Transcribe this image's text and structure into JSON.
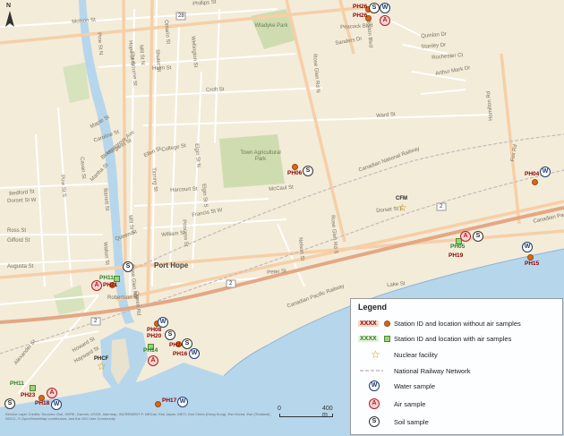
{
  "map": {
    "place_label": "Port Hope",
    "parks": [
      {
        "name": "Wladyke Park"
      },
      {
        "name": "Town Agricultural Park"
      }
    ],
    "streets": [
      "Molson St",
      "Phillips St",
      "Pine St N",
      "Ontario St",
      "Wellington St",
      "Mill St N",
      "Hope St N",
      "Sherbourne St",
      "Shuter St",
      "Helm St",
      "Croft St",
      "Ward St",
      "Peacock Blvd",
      "Sanders Dr",
      "Quinlan Dr",
      "Stanley Dr",
      "Rochester Ct",
      "Arthur Mark Dr",
      "Caroline St",
      "Margaret St",
      "Martha St",
      "Bloomsgrove Ave",
      "College St",
      "Ellen St",
      "Elgin St N",
      "Dorset St W",
      "Bedford St",
      "Pine St S",
      "Harcourt St",
      "Tinning St",
      "Barrett St",
      "McCaul St",
      "Elgin St S",
      "Francis St W",
      "William St",
      "Princess St",
      "Mill St S",
      "Ross St",
      "Gifford St",
      "Augusta St",
      "Robertson St",
      "Peter St",
      "Lake St",
      "Dorset St E",
      "Nelson St",
      "Rose Glen Rd N",
      "Rose Glen Rd S",
      "Hamilton Rd",
      "Bruton Blvd",
      "Alexander St",
      "Howard St",
      "Cavan St",
      "Maple St",
      "Walton St",
      "Hayward St",
      "Queen St",
      "Queen Rd",
      "Rose Glen Rd",
      "Fox Rd",
      "Canadian Pacific Railway",
      "Canadian National Railway",
      "Canadian Pacific"
    ],
    "road_shields": [
      "28",
      "2",
      "2",
      "2"
    ]
  },
  "stations": [
    {
      "id": "PH26",
      "air": false,
      "samples": [
        "S",
        "W"
      ]
    },
    {
      "id": "PH26",
      "air": false,
      "samples": [
        "A"
      ]
    },
    {
      "id": "PH06",
      "air": false,
      "samples": [
        "S"
      ]
    },
    {
      "id": "PH04",
      "air": false,
      "samples": [
        "W"
      ]
    },
    {
      "id": "PH05",
      "air": true,
      "samples": [
        "A",
        "S"
      ]
    },
    {
      "id": "PH19",
      "air": false,
      "samples": []
    },
    {
      "id": "PH15",
      "air": false,
      "samples": [
        "W"
      ]
    },
    {
      "id": "PH11",
      "air": true,
      "samples": [
        "S"
      ]
    },
    {
      "id": "PH21",
      "air": false,
      "samples": [
        "A"
      ]
    },
    {
      "id": "PH08",
      "air": false,
      "samples": [
        "W"
      ]
    },
    {
      "id": "PH20",
      "air": false,
      "samples": [
        "S"
      ]
    },
    {
      "id": "PH24",
      "air": false,
      "samples": [
        "S"
      ]
    },
    {
      "id": "PH14",
      "air": true,
      "samples": [
        "A"
      ]
    },
    {
      "id": "PH16",
      "air": false,
      "samples": [
        "W"
      ]
    },
    {
      "id": "PH17",
      "air": false,
      "samples": [
        "W"
      ]
    },
    {
      "id": "PH11",
      "air": true,
      "samples": [
        "A"
      ]
    },
    {
      "id": "PH23",
      "air": false,
      "samples": [
        "S"
      ]
    },
    {
      "id": "PH18",
      "air": false,
      "samples": [
        "W"
      ]
    }
  ],
  "facilities": [
    {
      "id": "CFM"
    },
    {
      "id": "PHCF"
    }
  ],
  "legend": {
    "title": "Legend",
    "station_placeholder": "XXXX",
    "items": [
      {
        "key": "noair",
        "label": "Station ID and location without air samples"
      },
      {
        "key": "air",
        "label": "Station ID and location with air samples"
      },
      {
        "key": "nuclear",
        "label": "Nuclear facility"
      },
      {
        "key": "rail",
        "label": "National Railway Network"
      },
      {
        "key": "water",
        "label": "Water sample"
      },
      {
        "key": "airs",
        "label": "Air sample"
      },
      {
        "key": "soil",
        "label": "Soil sample"
      }
    ],
    "badge_letters": {
      "water": "W",
      "air": "A",
      "soil": "S"
    }
  },
  "scalebar": {
    "start": "0",
    "end": "400 m"
  },
  "credits": "Service Layer Credits: Sources: Esri, HERE, Garmin, USGS, Intermap, INCREMENT P, NRCan, Esri Japan, METI, Esri China (Hong Kong), Esri Korea, Esri (Thailand), NGCC, © OpenStreetMap contributors, and the GIS User Community",
  "north_label": "N",
  "colors": {
    "land": "#f3ecd9",
    "water": "#b6d6ec",
    "park": "#cfdcb0",
    "road": "#ffffff",
    "arterial": "#f6cfa8",
    "highway": "#e4a784",
    "rail": "#c9b9b9",
    "station": "#d4691a"
  }
}
